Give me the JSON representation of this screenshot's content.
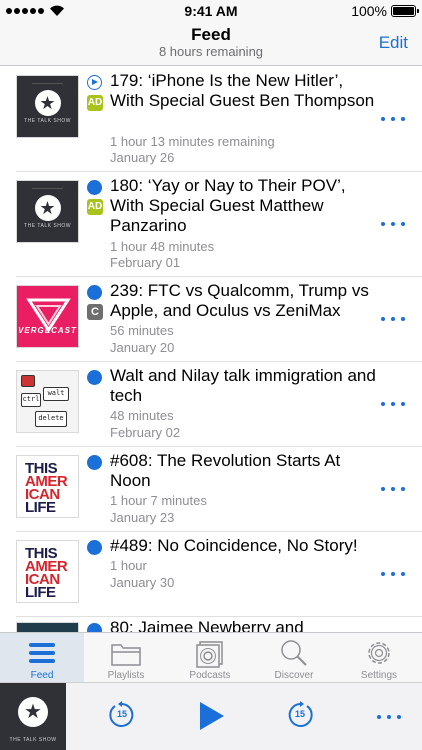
{
  "status_bar": {
    "time": "9:41 AM",
    "battery": "100%"
  },
  "nav": {
    "title": "Feed",
    "subtitle": "8 hours remaining",
    "edit_label": "Edit"
  },
  "episodes": [
    {
      "title": "179: ‘iPhone Is the New Hitler’, With Special Guest Ben Thompson",
      "duration": "1 hour 13 minutes remaining",
      "date": "January 26",
      "artwork": "the-talk-show",
      "artwork_label": "THE TALK SHOW",
      "badge": "AD",
      "status": "playing"
    },
    {
      "title": "180: ‘Yay or Nay to Their POV’, With Special Guest Matthew Panzarino",
      "duration": "1 hour 48 minutes",
      "date": "February 01",
      "artwork": "the-talk-show",
      "artwork_label": "THE TALK SHOW",
      "badge": "AD",
      "status": "unplayed"
    },
    {
      "title": "239: FTC vs Qualcomm, Trump vs Apple, and Oculus vs ZeniMax",
      "duration": "56 minutes",
      "date": "January 20",
      "artwork": "vergecast",
      "artwork_label": "VERGECAST",
      "badge": "C",
      "status": "unplayed"
    },
    {
      "title": "Walt and Nilay talk immigration and tech",
      "duration": "48 minutes",
      "date": "February 02",
      "artwork": "ctrl-walt-delete",
      "artwork_keys": [
        "ctrl",
        "walt",
        "delete"
      ],
      "status": "unplayed"
    },
    {
      "title": "#608: The Revolution Starts At Noon",
      "duration": "1 hour 7 minutes",
      "date": "January 23",
      "artwork": "this-american-life",
      "artwork_lines": [
        "THIS",
        "AMER",
        "ICAN",
        "LIFE"
      ],
      "status": "unplayed"
    },
    {
      "title": "#489: No Coincidence, No Story!",
      "duration": "1 hour",
      "date": "January 30",
      "artwork": "this-american-life",
      "artwork_lines": [
        "THIS",
        "AMER",
        "ICAN",
        "LIFE"
      ],
      "status": "unplayed"
    },
    {
      "title": "80: Jaimee Newberry and",
      "status": "unplayed"
    }
  ],
  "tabs": [
    {
      "label": "Feed",
      "icon": "list-icon",
      "active": true
    },
    {
      "label": "Playlists",
      "icon": "folder-icon",
      "active": false
    },
    {
      "label": "Podcasts",
      "icon": "podcasts-icon",
      "active": false
    },
    {
      "label": "Discover",
      "icon": "search-icon",
      "active": false
    },
    {
      "label": "Settings",
      "icon": "gear-icon",
      "active": false
    }
  ],
  "player": {
    "artwork_label": "THE TALK SHOW",
    "skip_back_seconds": "15",
    "skip_forward_seconds": "15"
  },
  "colors": {
    "accent": "#1a6fd8",
    "ad_badge": "#a9c21c",
    "chapter_badge": "#6e6e6e",
    "vergecast_pink": "#ea1e63",
    "talk_show_dark": "#2f3137"
  }
}
